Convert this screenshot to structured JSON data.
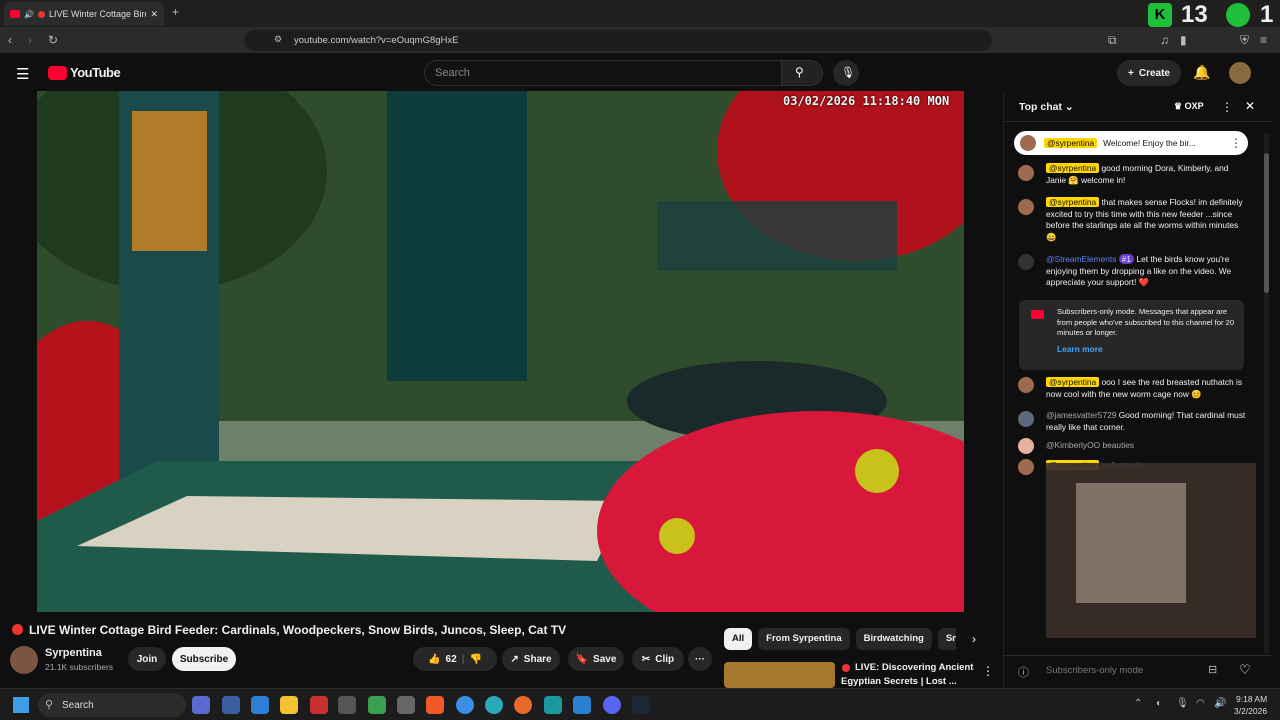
{
  "browser": {
    "tab_title": "LIVE Winter Cottage Bird F",
    "url": "youtube.com/watch?v=eOuqmG8gHxE",
    "score": "13",
    "side_digit": "1"
  },
  "youtube": {
    "logo": "YouTube",
    "search_placeholder": "Search",
    "create_label": "Create"
  },
  "video": {
    "timestamp": "03/02/2026  11:18:40 MON"
  },
  "meta": {
    "title": "LIVE Winter Cottage Bird Feeder: Cardinals, Woodpeckers, Snow Birds, Juncos, Sleep, Cat TV",
    "channel": "Syrpentina",
    "subscribers": "21.1K subscribers",
    "join": "Join",
    "subscribe": "Subscribe",
    "likes": "62",
    "share": "Share",
    "save": "Save",
    "clip": "Clip",
    "more": "···"
  },
  "recs": {
    "chips": [
      "All",
      "From Syrpentina",
      "Birdwatching",
      "Snow"
    ],
    "card_title_1": "LIVE: Discovering Ancient",
    "card_title_2": "Egyptian Secrets | Lost ..."
  },
  "chat": {
    "header": "Top chat",
    "badge": "OXP",
    "pinned": {
      "user": "@syrpentina",
      "text": "Welcome! Enjoy the bir..."
    },
    "messages": [
      {
        "user": "@syrpentina",
        "text": "good morning Dora, Kimberly, and Janie 🤗 welcome in!"
      },
      {
        "user": "@syrpentina",
        "text": "that makes sense Flocks! im definitely excited to try this time with this new feeder ...since before the starlings ate all the worms within minutes 😄"
      },
      {
        "user": "@StreamElements",
        "badge": "#1",
        "text": "Let the birds know you're enjoying them by dropping a like on the video. We appreciate your support! ❤️"
      },
      {
        "user": "@syrpentina",
        "text": "ooo I see the red breasted nuthatch is now cool with the new worm cage now 😊"
      },
      {
        "user": "@jamesvatter5729",
        "text": "Good morning! That cardinal must really like that corner."
      },
      {
        "user": "@KimberlyOO",
        "text": "beauties"
      },
      {
        "user": "@syrpentina",
        "text": "welcome in"
      }
    ],
    "notice": {
      "text": "Subscribers-only mode. Messages that appear are from people who've subscribed to this channel for 20 minutes or longer.",
      "link": "Learn more"
    },
    "input_placeholder": "Subscribers-only mode"
  },
  "taskbar": {
    "search": "Search",
    "time": "9:18 AM",
    "date": "3/2/2026"
  }
}
